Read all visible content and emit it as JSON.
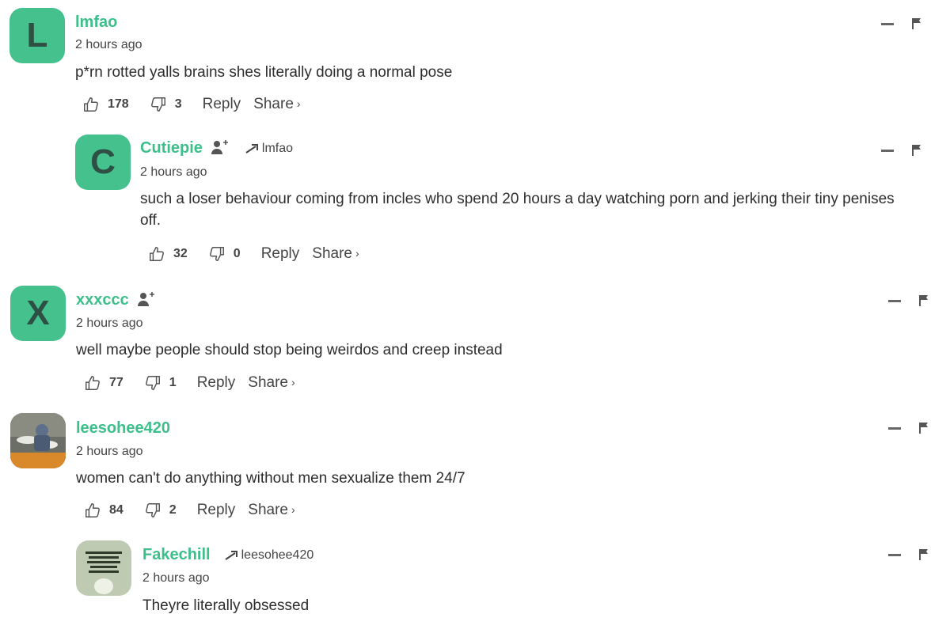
{
  "comments": [
    {
      "avatar_letter": "L",
      "username": "lmfao",
      "time": "2 hours ago",
      "text": "p*rn rotted yalls brains shes literally doing a normal pose",
      "likes": "178",
      "dislikes": "3",
      "reply_label": "Reply",
      "share_label": "Share",
      "share_chevron": "›"
    },
    {
      "avatar_letter": "C",
      "username": "Cutiepie",
      "reply_to": "lmfao",
      "time": "2 hours ago",
      "text_line1": "such a loser behaviour coming from incles who spend 20 hours a day watching porn and jerking their tiny penises",
      "text_line2": "off.",
      "likes": "32",
      "dislikes": "0",
      "reply_label": "Reply",
      "share_label": "Share",
      "share_chevron": "›"
    },
    {
      "avatar_letter": "X",
      "username": "xxxccc",
      "time": "2 hours ago",
      "text": "well maybe people should stop being weirdos and creep instead",
      "likes": "77",
      "dislikes": "1",
      "reply_label": "Reply",
      "share_label": "Share",
      "share_chevron": "›"
    },
    {
      "username": "leesohee420",
      "time": "2 hours ago",
      "text": "women can't do anything without men sexualize them 24/7",
      "likes": "84",
      "dislikes": "2",
      "reply_label": "Reply",
      "share_label": "Share",
      "share_chevron": "›"
    },
    {
      "username": "Fakechill",
      "reply_to": "leesohee420",
      "time": "2 hours ago",
      "text": "Theyre literally obsessed"
    }
  ],
  "colors": {
    "accent": "#3cbf8b",
    "avatar_bg": "#45c18e",
    "avatar_letter": "#2e4f43",
    "text": "#2d2d2d",
    "meta": "#444444"
  },
  "icons": {
    "like": "thumbs-up-icon",
    "dislike": "thumbs-down-icon",
    "follow": "add-user-icon",
    "reply_arrow": "reply-arrow-icon",
    "collapse": "collapse-icon",
    "flag": "flag-icon"
  }
}
